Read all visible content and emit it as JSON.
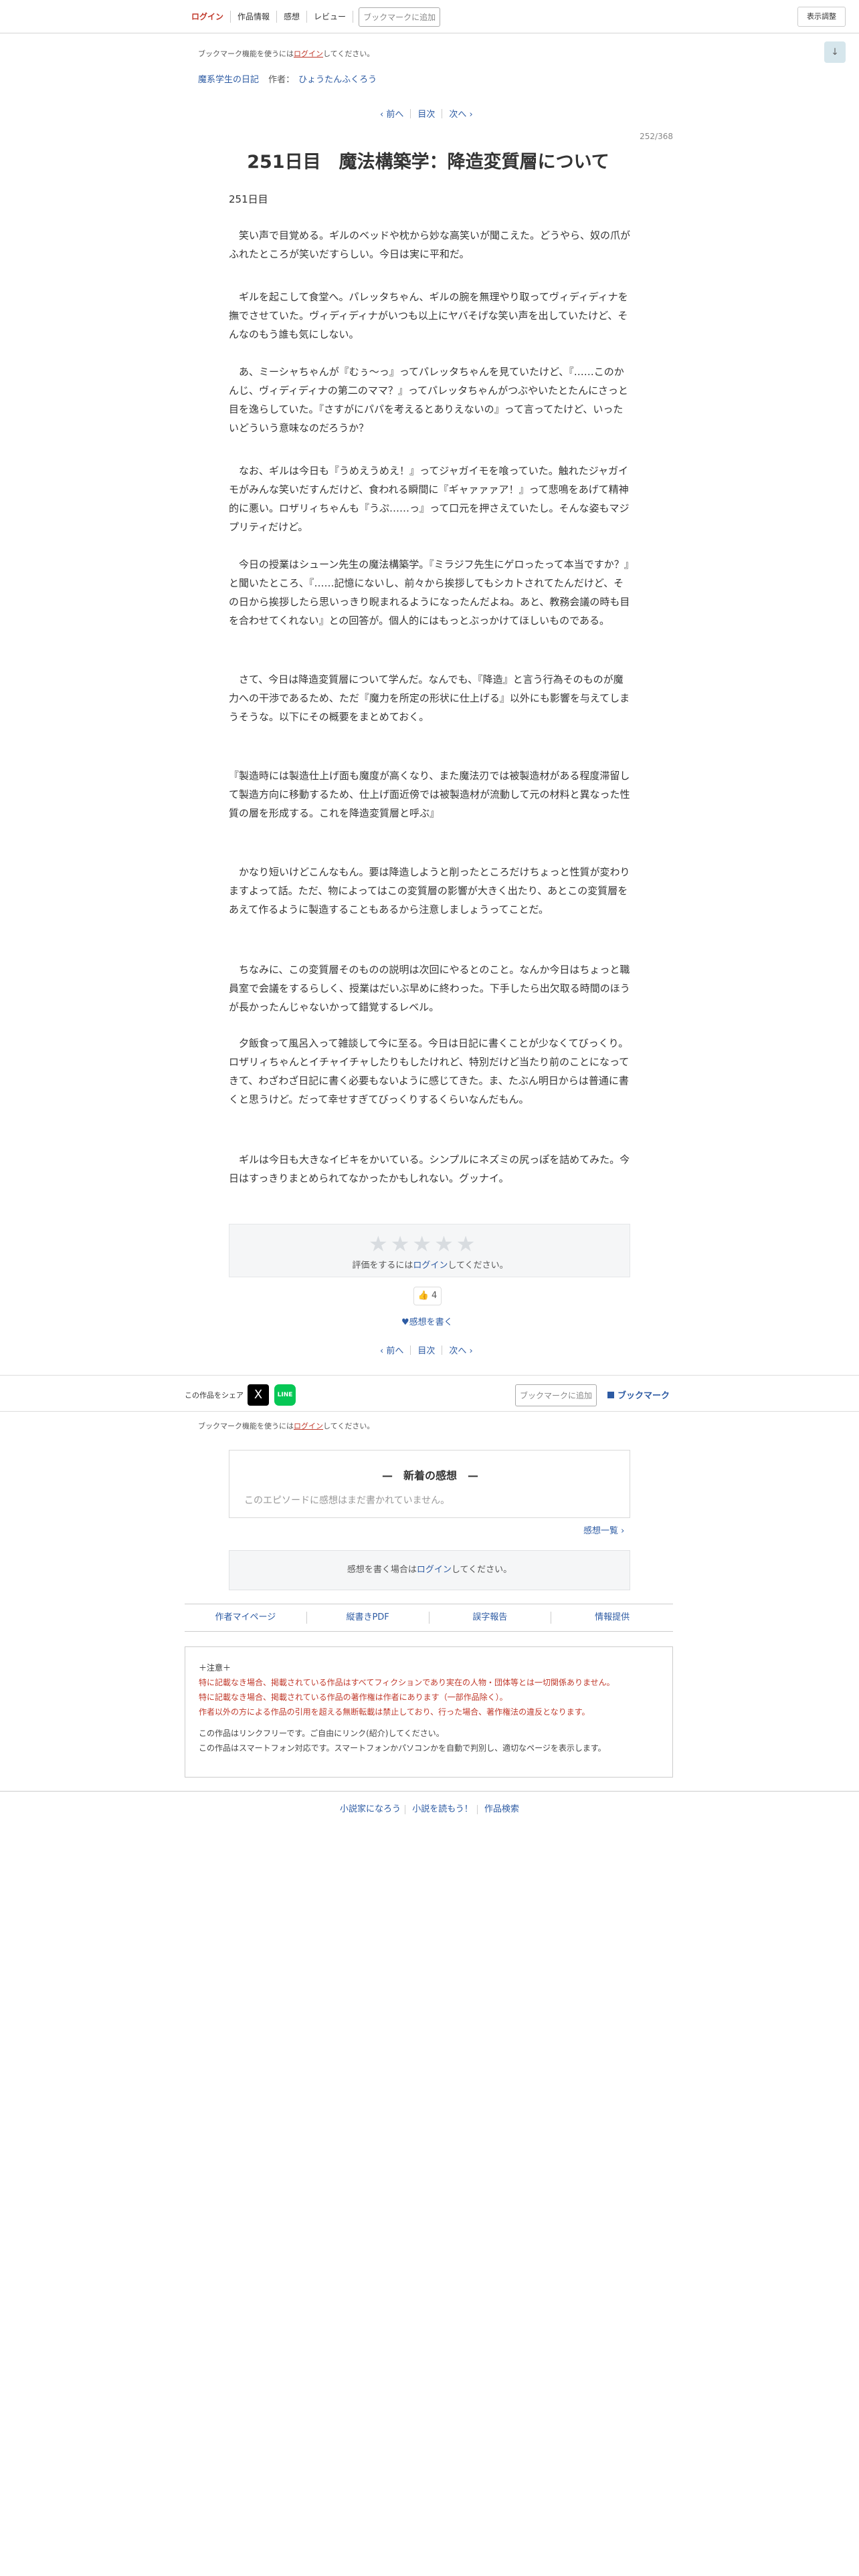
{
  "header": {
    "login": "ログイン",
    "nav": [
      "作品情報",
      "感想",
      "レビュー"
    ],
    "bookmark_add": "ブックマークに追加",
    "display_settings": "表示調整",
    "scroll_top": "↓"
  },
  "bookmark_notice": {
    "prefix": "ブックマーク機能を使うには",
    "login": "ログイン",
    "suffix": "してください。"
  },
  "work": {
    "series": "魔系学生の日記",
    "author_label": "作者：",
    "author": "ひょうたんふくろう"
  },
  "pager": {
    "prev": "‹ 前へ",
    "toc": "目次",
    "next": "次へ ›"
  },
  "page_count": "252/368",
  "chapter": {
    "title": "251日目　魔法構築学：降造変質層について",
    "subtitle": "251日目",
    "paragraphs": [
      "　笑い声で目覚める。ギルのベッドや枕から妙な高笑いが聞こえた。どうやら、奴の爪がふれたところが笑いだすらしい。今日は実に平和だ。",
      "　ギルを起こして食堂へ。パレッタちゃん、ギルの腕を無理やり取ってヴィディディナを撫でさせていた。ヴィディディナがいつも以上にヤバそげな笑い声を出していたけど、そんなのもう誰も気にしない。",
      "　あ、ミーシャちゃんが『むぅ～っ』ってパレッタちゃんを見ていたけど、『……このかんじ、ヴィディディナの第二のママ？』ってパレッタちゃんがつぶやいたとたんにさっと目を逸らしていた。『さすがにパパを考えるとありえないの』って言ってたけど、いったいどういう意味なのだろうか？",
      "　なお、ギルは今日も『うめえうめえ！』ってジャガイモを喰っていた。触れたジャガイモがみんな笑いだすんだけど、食われる瞬間に『ギャァァァア！』って悲鳴をあげて精神的に悪い。ロザリィちゃんも『うぷ……っ』って口元を押さえていたし。そんな姿もマジプリティだけど。",
      "　今日の授業はシューン先生の魔法構築学。『ミラジフ先生にゲロったって本当ですか？』と聞いたところ、『……記憶にないし、前々から挨拶してもシカトされてたんだけど、その日から挨拶したら思いっきり睨まれるようになったんだよね。あと、教務会議の時も目を合わせてくれない』との回答が。個人的にはもっとぶっかけてほしいものである。",
      "　さて、今日は降造変質層について学んだ。なんでも、『降造』と言う行為そのものが魔力への干渉であるため、ただ『魔力を所定の形状に仕上げる』以外にも影響を与えてしまうそうな。以下にその概要をまとめておく。",
      "『製造時には製造仕上げ面も魔度が高くなり、また魔法刃では被製造材がある程度滞留して製造方向に移動するため、仕上げ面近傍では被製造材が流動して元の材料と異なった性質の層を形成する。これを降造変質層と呼ぶ』",
      "　かなり短いけどこんなもん。要は降造しようと削ったところだけちょっと性質が変わりますよって話。ただ、物によってはこの変質層の影響が大きく出たり、あとこの変質層をあえて作るように製造することもあるから注意しましょうってことだ。",
      "　ちなみに、この変質層そのものの説明は次回にやるとのこと。なんか今日はちょっと職員室で会議をするらしく、授業はだいぶ早めに終わった。下手したら出欠取る時間のほうが長かったんじゃないかって錯覚するレベル。",
      "　夕飯食って風呂入って雑談して今に至る。今日は日記に書くことが少なくてびっくり。ロザリィちゃんとイチャイチャしたりもしたけれど、特別だけど当たり前のことになってきて、わざわざ日記に書く必要もないように感じてきた。ま、たぶん明日からは普通に書くと思うけど。だって幸せすぎてびっくりするくらいなんだもん。",
      "　ギルは今日も大きなイビキをかいている。シンプルにネズミの尻っぽを詰めてみた。今日はすっきりまとめられてなかったかもしれない。グッナイ。"
    ]
  },
  "rating": {
    "stars": "★★★★★",
    "prefix": "評価をするには",
    "login": "ログイン",
    "suffix": "してください。"
  },
  "like": {
    "icon": "👍",
    "count": "4"
  },
  "write_impression": "♥感想を書く",
  "share": {
    "label": "この作品をシェア",
    "x": "X",
    "line": "LINE"
  },
  "bookmark": {
    "add": "ブックマークに追加",
    "label": "ブックマーク"
  },
  "impressions": {
    "heading": "—　新着の感想　—",
    "empty": "このエピソードに感想はまだ書かれていません。",
    "list_link": "感想一覧 ›",
    "login_prefix": "感想を書く場合は",
    "login": "ログイン",
    "login_suffix": "してください。"
  },
  "links": [
    "作者マイページ",
    "縦書きPDF",
    "誤字報告",
    "情報提供"
  ],
  "notice": {
    "heading": "＋注意＋",
    "red_lines": [
      "特に記載なき場合、掲載されている作品はすべてフィクションであり実在の人物・団体等とは一切関係ありません。",
      "特に記載なき場合、掲載されている作品の著作権は作者にあります（一部作品除く）。",
      "作者以外の方による作品の引用を超える無断転載は禁止しており、行った場合、著作権法の違反となります。"
    ],
    "gray_lines": [
      "この作品はリンクフリーです。ご自由にリンク(紹介)してください。",
      "この作品はスマートフォン対応です。スマートフォンかパソコンかを自動で判別し、適切なページを表示します。"
    ]
  },
  "footer": [
    "小説家になろう",
    "小説を読もう！",
    "作品検索"
  ],
  "colors": {
    "link": "#2d5ba3",
    "login_red": "#c0392b",
    "box_bg": "#f5f6f7"
  }
}
